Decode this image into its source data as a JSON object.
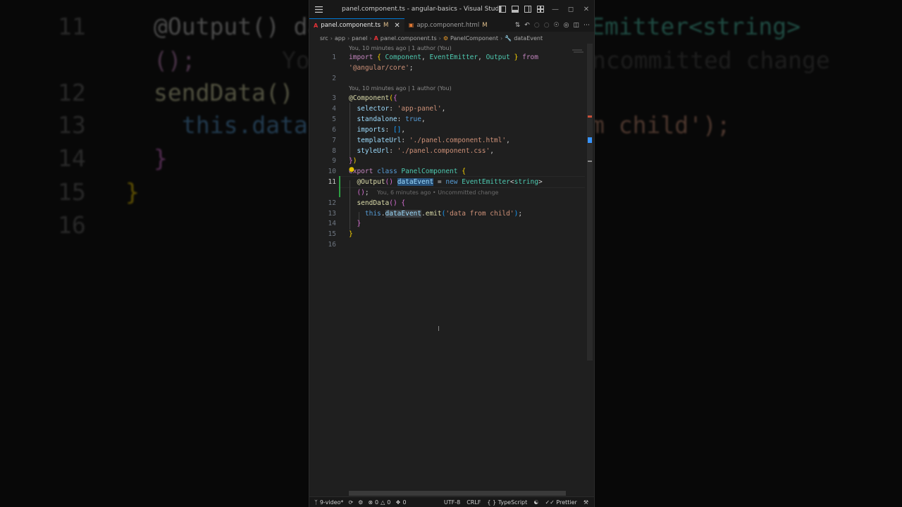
{
  "window": {
    "title": "panel.component.ts - angular-basics - Visual Studio Co..."
  },
  "tabs": [
    {
      "label": "panel.component.ts",
      "status": "M",
      "icon": "angular-icon",
      "active": true
    },
    {
      "label": "app.component.html",
      "status": "M",
      "icon": "html-icon",
      "active": false
    }
  ],
  "breadcrumb": {
    "items": [
      "src",
      "app",
      "panel",
      "panel.component.ts",
      "PanelComponent",
      "dataEvent"
    ]
  },
  "codelens": {
    "top": "You, 10 minutes ago | 1 author (You)",
    "component": "You, 10 minutes ago | 1 author (You)"
  },
  "editor": {
    "current_line": 11,
    "line_numbers": [
      "1",
      "2",
      "3",
      "4",
      "5",
      "6",
      "7",
      "8",
      "9",
      "10",
      "11",
      "12",
      "13",
      "14",
      "15",
      "16"
    ],
    "lines": {
      "l1a": "import",
      "l1b": "{",
      "l1c": "Component",
      "l1d": "EventEmitter",
      "l1e": "Output",
      "l1f": "}",
      "l1g": "from",
      "l1h": "'@angular/core'",
      "l3a": "@Component",
      "l4a": "selector",
      "l4b": "'app-panel'",
      "l5a": "standalone",
      "l5b": "true",
      "l6a": "imports",
      "l7a": "templateUrl",
      "l7b": "'./panel.component.html'",
      "l8a": "styleUrl",
      "l8b": "'./panel.component.css'",
      "l10a": "export",
      "l10b": "class",
      "l10c": "PanelComponent",
      "l11a": "@Output",
      "l11b": "dataEvent",
      "l11c": "new",
      "l11d": "EventEmitter",
      "l11e": "string",
      "l11ghost": "You, 6 minutes ago • Uncommitted change",
      "l12a": "sendData",
      "l13a": "this",
      "l13b": "dataEvent",
      "l13c": "emit",
      "l13d": "'data from child'"
    }
  },
  "background_zoom": {
    "n11": "11",
    "n12": "12",
    "n13": "13",
    "n14": "14",
    "n15": "15",
    "n16": "16",
    "t11": "@Output() da",
    "t11r": "Emitter<string>",
    "t11b": "();",
    "t11g": "Yo",
    "t11g2": "ncommitted change",
    "t12": "sendData()",
    "t13": "this.data",
    "t13r": "m child');",
    "t14": "}",
    "t15": "}"
  },
  "statusbar": {
    "branch": "9-video*",
    "errors": "0",
    "warnings": "0",
    "ports": "0",
    "encoding": "UTF-8",
    "eol": "CRLF",
    "language": "TypeScript",
    "formatter": "Prettier"
  },
  "colors": {
    "accent": "#0078d4",
    "editor_bg": "#1f1f1f",
    "keyword": "#c586c0",
    "string": "#ce9178",
    "class": "#4ec9b0",
    "property": "#9cdcfe"
  }
}
